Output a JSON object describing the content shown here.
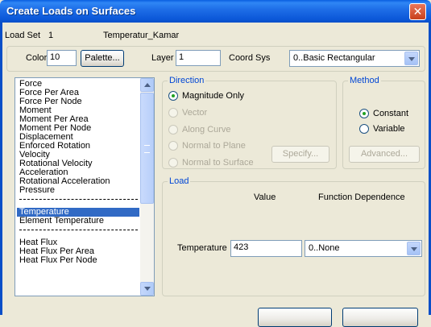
{
  "window": {
    "title": "Create Loads on Surfaces",
    "close_glyph": "✕"
  },
  "header": {
    "load_set_label": "Load Set",
    "load_set_id": "1",
    "load_set_name": "Temperatur_Kamar"
  },
  "top_controls": {
    "color_label": "Color",
    "color_value": "10",
    "palette_button": "Palette...",
    "layer_label": "Layer",
    "layer_value": "1",
    "coordsys_label": "Coord Sys",
    "coordsys_value": "0..Basic Rectangular"
  },
  "load_types": [
    {
      "label": "Force"
    },
    {
      "label": "Force Per Area"
    },
    {
      "label": "Force Per Node"
    },
    {
      "label": "Moment"
    },
    {
      "label": "Moment Per Area"
    },
    {
      "label": "Moment Per Node"
    },
    {
      "label": "Displacement"
    },
    {
      "label": "Enforced Rotation"
    },
    {
      "label": "Velocity"
    },
    {
      "label": "Rotational Velocity"
    },
    {
      "label": "Acceleration"
    },
    {
      "label": "Rotational Acceleration"
    },
    {
      "label": "Pressure"
    },
    {
      "label": ""
    },
    {
      "label": "Temperature",
      "selected": true
    },
    {
      "label": "Element Temperature"
    },
    {
      "label": ""
    },
    {
      "label": "Heat Flux"
    },
    {
      "label": "Heat Flux Per Area"
    },
    {
      "label": "Heat Flux Per Node"
    }
  ],
  "direction": {
    "title": "Direction",
    "options": [
      "Magnitude Only",
      "Vector",
      "Along Curve",
      "Normal to Plane",
      "Normal to Surface"
    ],
    "selected": "Magnitude Only",
    "specify_button": "Specify..."
  },
  "method": {
    "title": "Method",
    "options": [
      "Constant",
      "Variable"
    ],
    "selected": "Constant",
    "advanced_button": "Advanced..."
  },
  "load": {
    "title": "Load",
    "value_header": "Value",
    "function_header": "Function Dependence",
    "row_label": "Temperature",
    "value": "423",
    "function_value": "0..None"
  },
  "colors": {
    "title_bar": "#0a5fe0",
    "dialog_bg": "#ece9d8",
    "group_title": "#0046d5",
    "selection": "#316ac5",
    "close_button": "#c8401c"
  }
}
